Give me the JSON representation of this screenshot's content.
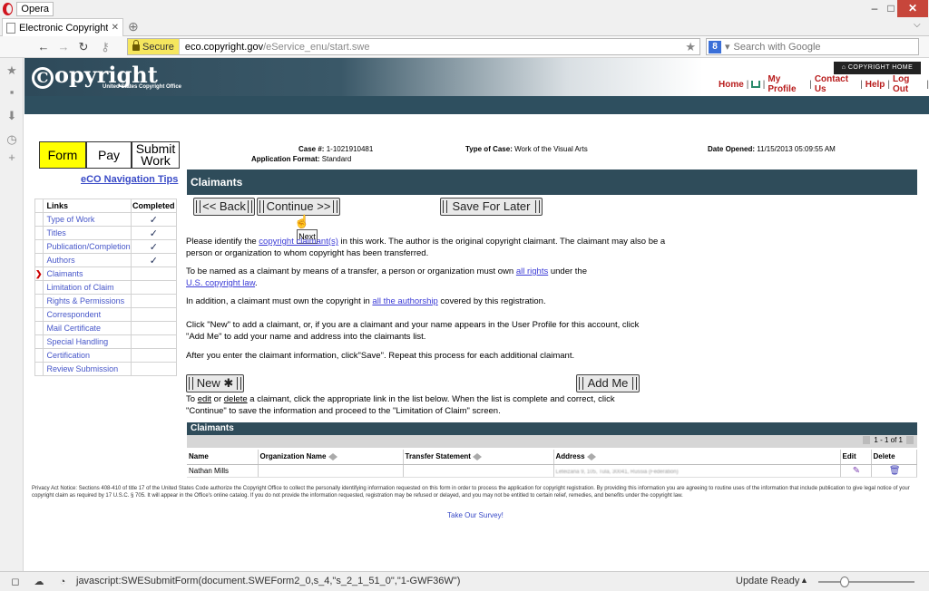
{
  "browser": {
    "menu_label": "Opera",
    "tab_title": "Electronic Copyright O...",
    "url_secure_label": "Secure",
    "url_host": "eco.copyright.gov",
    "url_path": "/eService_enu/start.swe",
    "search_placeholder": "Search with Google",
    "status_text": "javascript:SWESubmitForm(document.SWEForm2_0,s_4,\"s_2_1_51_0\",\"1-GWF36W\")",
    "status_right": "Update Ready"
  },
  "header": {
    "logo_text": "opyright",
    "logo_sub": "United States Copyright Office",
    "copyright_home": "COPYRIGHT HOME",
    "nav": [
      "Home",
      "My Profile",
      "Contact Us",
      "Help",
      "Log Out"
    ]
  },
  "steps": {
    "form": "Form",
    "pay": "Pay",
    "submit_line1": "Submit",
    "submit_line2": "Work"
  },
  "nav_tips": "eCO Navigation Tips",
  "links_table": {
    "col_links": "Links",
    "col_completed": "Completed",
    "rows": [
      {
        "label": "Type of Work",
        "completed": true,
        "current": false
      },
      {
        "label": "Titles",
        "completed": true,
        "current": false
      },
      {
        "label": "Publication/Completion",
        "completed": true,
        "current": false
      },
      {
        "label": "Authors",
        "completed": true,
        "current": false
      },
      {
        "label": "Claimants",
        "completed": false,
        "current": true
      },
      {
        "label": "Limitation of Claim",
        "completed": false,
        "current": false
      },
      {
        "label": "Rights & Permissions",
        "completed": false,
        "current": false
      },
      {
        "label": "Correspondent",
        "completed": false,
        "current": false
      },
      {
        "label": "Mail Certificate",
        "completed": false,
        "current": false
      },
      {
        "label": "Special Handling",
        "completed": false,
        "current": false
      },
      {
        "label": "Certification",
        "completed": false,
        "current": false
      },
      {
        "label": "Review Submission",
        "completed": false,
        "current": false
      }
    ]
  },
  "case": {
    "case_label": "Case #:",
    "case_value": "1-1021910481",
    "format_label": "Application Format:",
    "format_value": "Standard",
    "type_label": "Type of Case:",
    "type_value": "Work of the Visual Arts",
    "date_label": "Date Opened:",
    "date_value": "11/15/2013 05:09:55 AM"
  },
  "section_title": "Claimants",
  "buttons": {
    "back": "<< Back",
    "continue": "Continue >>",
    "save_later": "Save For Later",
    "new": "New ✱",
    "add_me": "Add Me"
  },
  "tooltip": "Next",
  "paragraphs": {
    "p1_a": "Please identify the ",
    "p1_link": "copyright claimant(s)",
    "p1_b": " in this work. The author is the original copyright claimant. The claimant may also be a person or organization to whom copyright has been transferred.",
    "p2_a": "To be named as a claimant by means of a transfer, a person or organization must own ",
    "p2_link1": "all rights",
    "p2_b": " under the ",
    "p2_link2": "U.S. copyright law",
    "p2_c": ".",
    "p3_a": "In addition, a claimant must own the copyright in ",
    "p3_link": "all the authorship",
    "p3_b": " covered by this registration.",
    "p4": "Click \"New\" to add a claimant, or, if you are a claimant and your name appears in the User Profile for this account, click \"Add Me\" to add your name and address into the claimants list.",
    "p5": "After you enter the claimant information, click\"Save\". Repeat this process for each additional claimant.",
    "p6_a": "To ",
    "p6_edit": "edit",
    "p6_b": " or ",
    "p6_delete": "delete",
    "p6_c": " a claimant, click the appropriate link in the list below. When the list is complete and correct, click \"Continue\" to save the information and proceed to the \"Limitation of Claim\" screen."
  },
  "claims": {
    "title": "Claimants",
    "pager": "1 - 1 of 1",
    "columns": [
      "Name",
      "Organization Name",
      "Transfer Statement",
      "Address",
      "Edit",
      "Delete"
    ],
    "rows": [
      {
        "name": "Nathan Mills",
        "org": "",
        "transfer": "",
        "address": "Leteizana 9, 105, Tula, 30041, Russia (Federation)"
      }
    ]
  },
  "privacy": "Privacy Act Notice: Sections 408-410 of title 17 of the United States Code authorize the Copyright Office to collect the personally identifying information requested on this form in order to process the application for copyright registration. By providing this information you are agreeing to routine uses of the information that include publication to give legal notice of your copyright claim as required by 17 U.S.C. § 705. It will appear in the Office's online catalog. If you do not provide the information requested, registration may be refused or delayed, and you may not be entitled to certain relief, remedies, and benefits under the copyright law.",
  "survey": "Take Our Survey!"
}
